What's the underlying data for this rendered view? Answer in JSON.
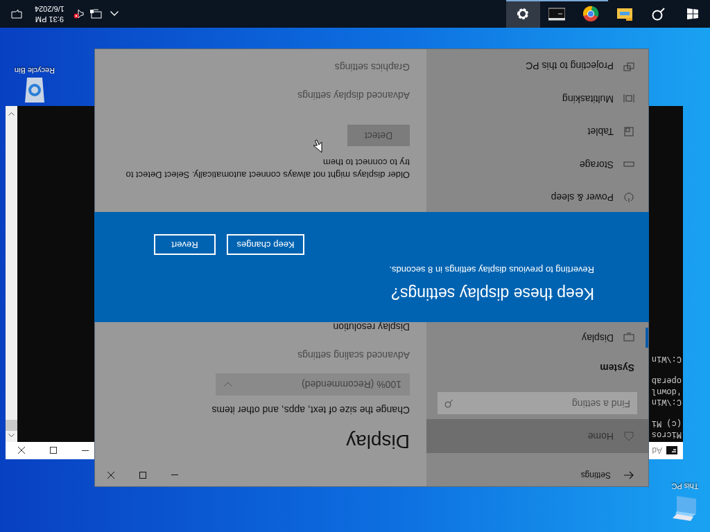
{
  "desktop_icons": [
    {
      "kind": "pc",
      "label": "This PC"
    },
    {
      "kind": "bin",
      "label": "Recycle Bin"
    }
  ],
  "console": {
    "title": "Ad",
    "paragraphs": [
      [
        "Micros",
        "(c) Mi"
      ],
      [
        "C:\\Win",
        "'downl",
        "operab"
      ],
      [
        "C:\\Win"
      ]
    ]
  },
  "settings": {
    "title": "Settings",
    "home": {
      "label": "Home",
      "hovered": true
    },
    "search": {
      "placeholder": "Find a setting"
    },
    "category": "System",
    "items": [
      {
        "kind": "display",
        "label": "Display",
        "selected": true
      },
      {
        "kind": "power",
        "label": "Power & sleep",
        "selected": false
      },
      {
        "kind": "storage",
        "label": "Storage",
        "selected": false
      },
      {
        "kind": "tablet",
        "label": "Tablet",
        "selected": false
      },
      {
        "kind": "multitasking",
        "label": "Multitasking",
        "selected": false
      },
      {
        "kind": "projecting",
        "label": "Projecting to this PC",
        "selected": false
      }
    ],
    "content_top": [
      {
        "kind": "heading",
        "text": "Display"
      },
      {
        "kind": "label",
        "text": "Change the size of text, apps, and other items"
      },
      {
        "kind": "dropdown",
        "text": "100% (Recommended)"
      },
      {
        "kind": "link",
        "text": "Advanced scaling settings"
      },
      {
        "kind": "label",
        "text": "Display resolution"
      }
    ],
    "content_bottom": [
      {
        "kind": "paragraph",
        "text": "Older displays might not always connect automatically. Select Detect to try to connect to them"
      },
      {
        "kind": "button",
        "text": "Detect"
      },
      {
        "kind": "link",
        "text": "Advanced display settings"
      },
      {
        "kind": "link",
        "text": "Graphics settings"
      }
    ]
  },
  "dialog": {
    "title": "Keep these display settings?",
    "message": "Reverting to previous display settings in  8 seconds.",
    "buttons": [
      "Keep changes",
      "Revert"
    ]
  },
  "taskbar": {
    "apps": [
      {
        "kind": "explorer",
        "running": false,
        "selected": false
      },
      {
        "kind": "chrome",
        "running": true,
        "selected": false
      },
      {
        "kind": "terminal",
        "running": true,
        "selected": false
      },
      {
        "kind": "settings",
        "running": true,
        "selected": true
      }
    ],
    "volume_muted": true,
    "time": "9:31 PM",
    "date": "1/6/2024"
  }
}
